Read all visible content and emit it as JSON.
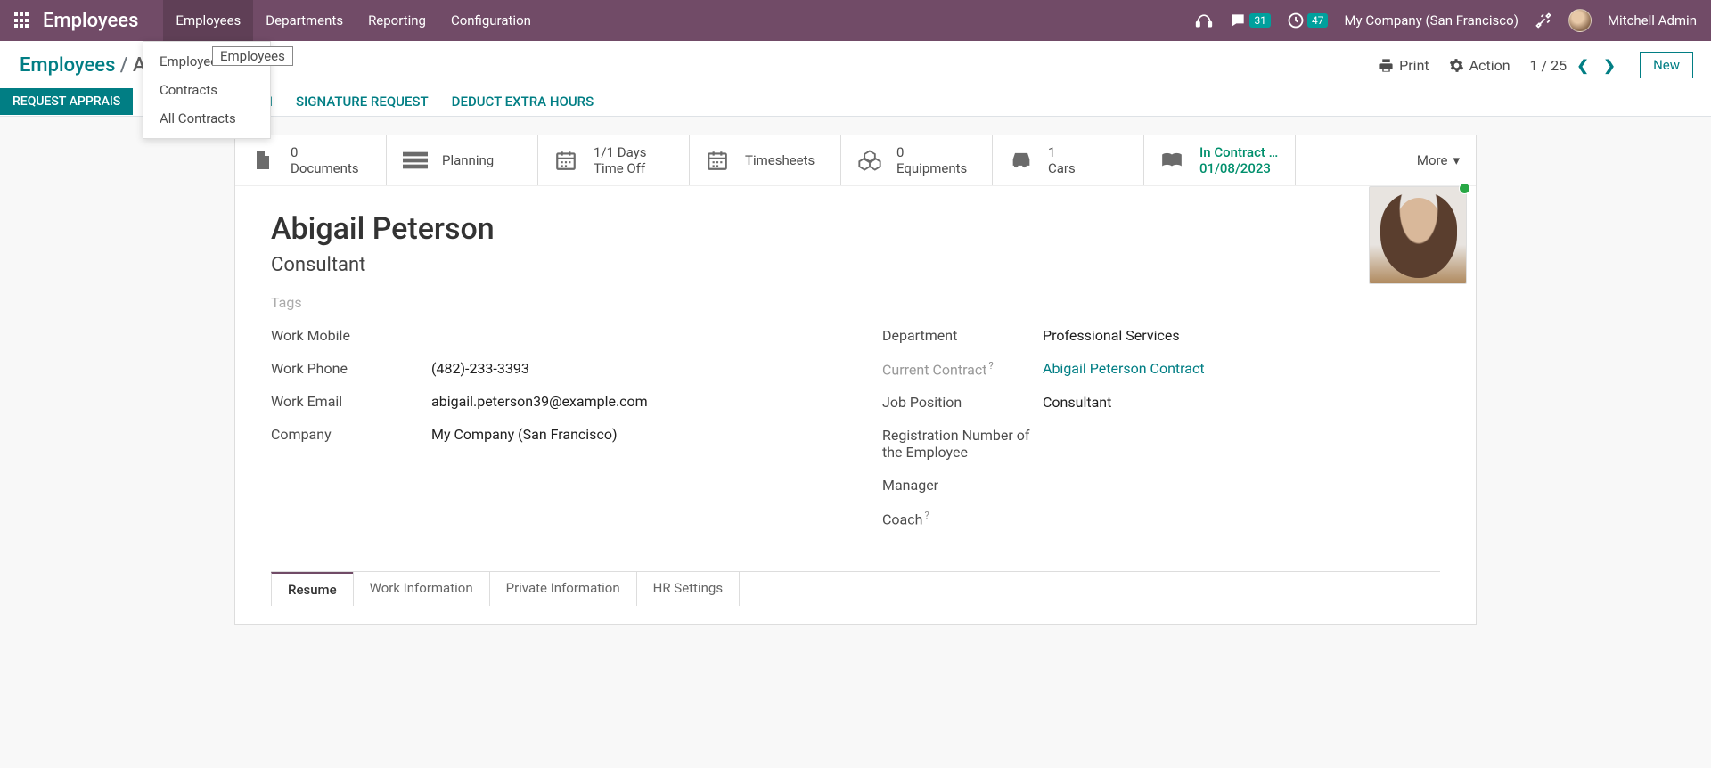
{
  "topnav": {
    "brand": "Employees",
    "menu": [
      "Employees",
      "Departments",
      "Reporting",
      "Configuration"
    ],
    "msg_badge": "31",
    "activity_badge": "47",
    "company": "My Company (San Francisco)",
    "user": "Mitchell Admin"
  },
  "dropdown": {
    "items": [
      "Employees",
      "Contracts",
      "All Contracts"
    ],
    "tooltip": "Employees"
  },
  "breadcrumb": {
    "root": "Employees",
    "sep": "/",
    "current": "A"
  },
  "cp": {
    "print": "Print",
    "action": "Action",
    "pager": "1 / 25",
    "new": "New"
  },
  "statusbar": {
    "primary": "REQUEST APPRAIS",
    "trailing_letter": "N",
    "signature": "SIGNATURE REQUEST",
    "deduct": "DEDUCT EXTRA HOURS"
  },
  "stats": {
    "documents": {
      "val": "0",
      "label": "Documents"
    },
    "planning": {
      "label": "Planning"
    },
    "timeoff": {
      "val": "1/1 Days",
      "label": "Time Off"
    },
    "timesheets": {
      "label": "Timesheets"
    },
    "equipments": {
      "val": "0",
      "label": "Equipments"
    },
    "cars": {
      "val": "1",
      "label": "Cars"
    },
    "contract": {
      "val": "In Contract …",
      "label": "01/08/2023"
    },
    "more": "More"
  },
  "employee": {
    "name": "Abigail Peterson",
    "title": "Consultant",
    "tags_placeholder": "Tags",
    "left": {
      "work_mobile_label": "Work Mobile",
      "work_mobile": "",
      "work_phone_label": "Work Phone",
      "work_phone": "(482)-233-3393",
      "work_email_label": "Work Email",
      "work_email": "abigail.peterson39@example.com",
      "company_label": "Company",
      "company": "My Company (San Francisco)"
    },
    "right": {
      "department_label": "Department",
      "department": "Professional Services",
      "contract_label": "Current Contract",
      "contract": "Abigail Peterson Contract",
      "position_label": "Job Position",
      "position": "Consultant",
      "regnum_label": "Registration Number of the Employee",
      "regnum": "",
      "manager_label": "Manager",
      "manager": "",
      "coach_label": "Coach",
      "coach": ""
    }
  },
  "tabs": [
    "Resume",
    "Work Information",
    "Private Information",
    "HR Settings"
  ]
}
